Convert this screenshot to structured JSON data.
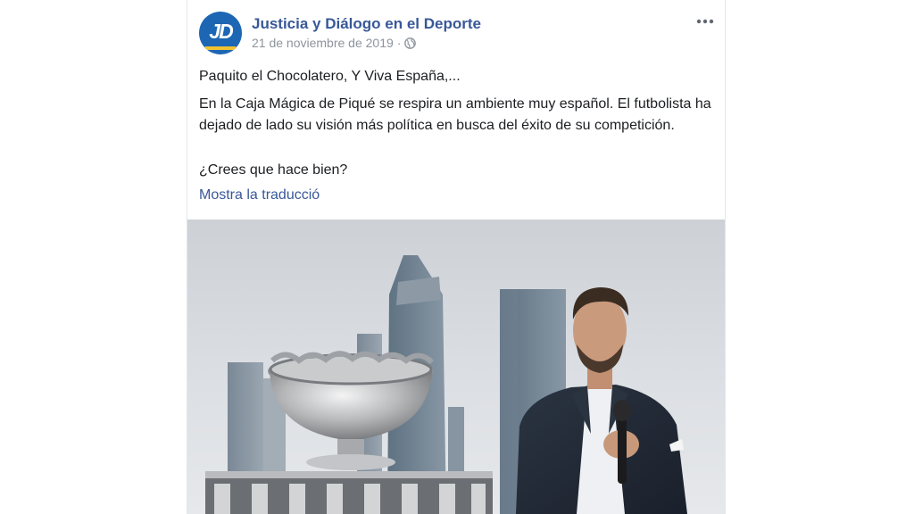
{
  "post": {
    "page_name": "Justicia y Diálogo en el Deporte",
    "avatar_initials": "JD",
    "date": "21 de noviembre de 2019",
    "separator": "·",
    "audience_icon": "globe-icon",
    "more_icon": "more-options-icon",
    "text": {
      "line1": "Paquito el Chocolatero, Y Viva España,...",
      "paragraph": "En la Caja Mágica de Piqué se respira un ambiente muy español. El futbolista ha dejado de lado su visión más política en busca del éxito de su competición.",
      "question": "¿Crees que hace bien?"
    },
    "translate_link": "Mostra la traducció"
  },
  "colors": {
    "link": "#385898",
    "text": "#1c1e21",
    "meta": "#8d949e",
    "avatar_bg": "#1d66b3",
    "avatar_accent": "#f2c230"
  }
}
